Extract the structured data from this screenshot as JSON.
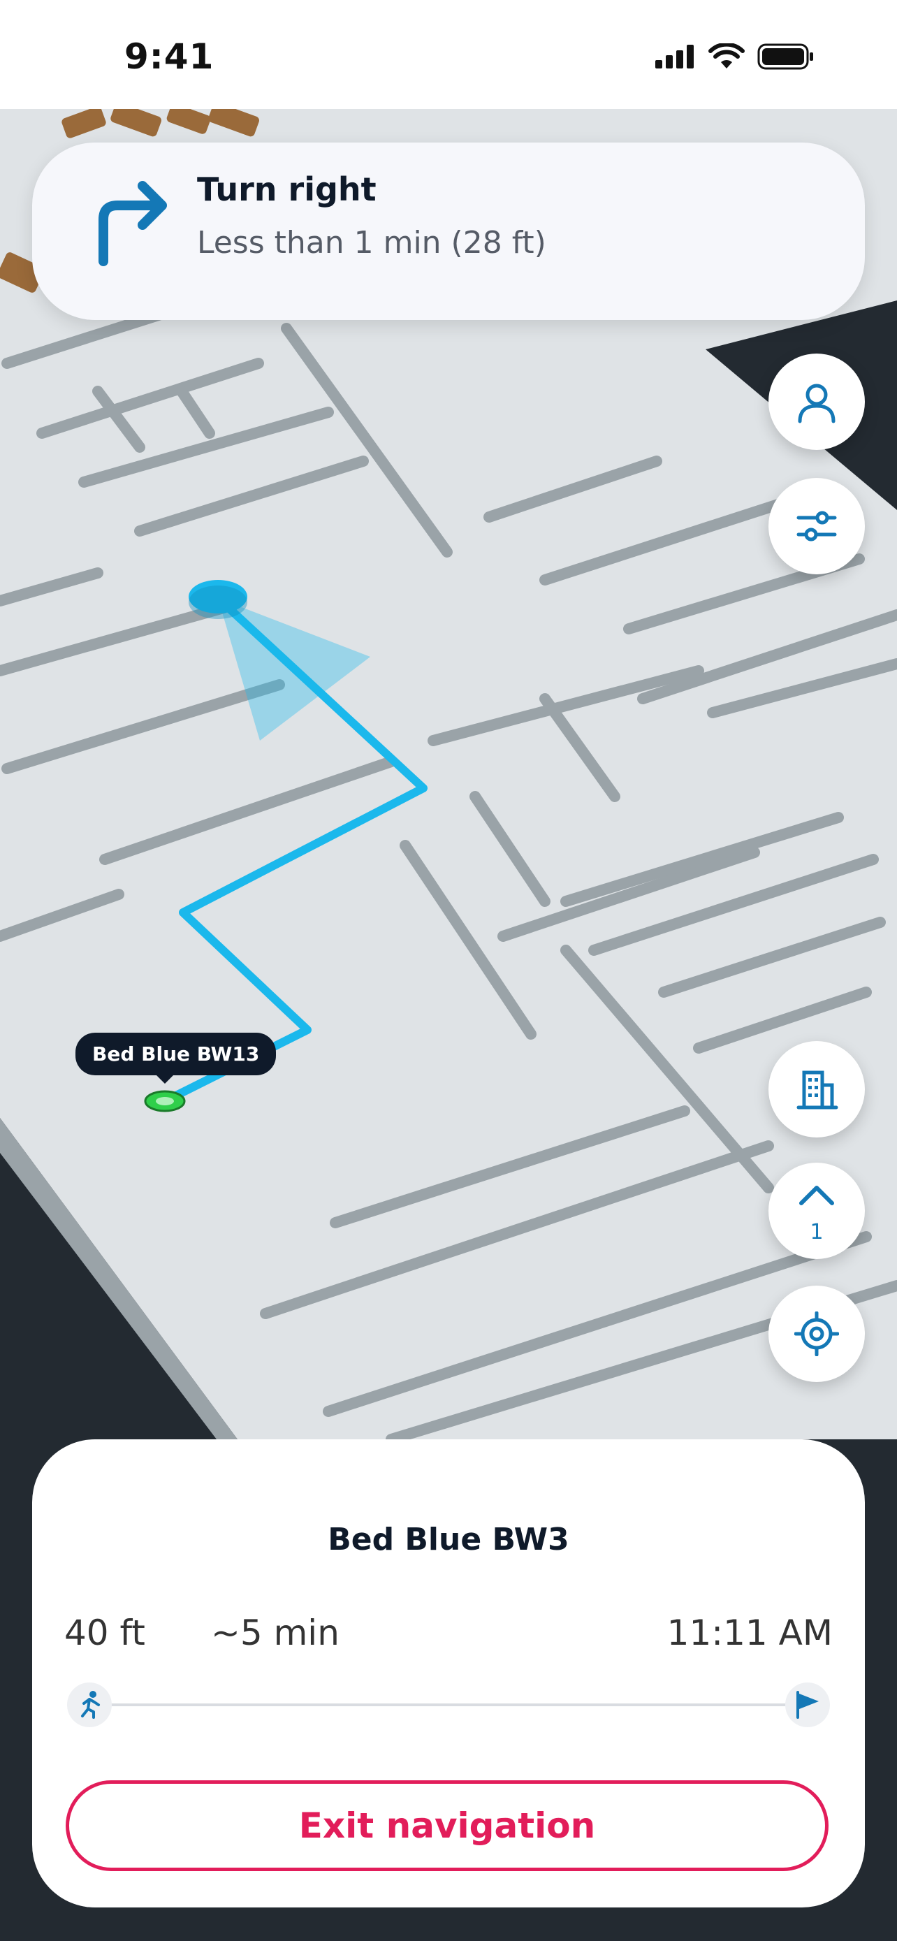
{
  "status_bar": {
    "time": "9:41"
  },
  "navigation": {
    "instruction": "Turn right",
    "detail": "Less than 1 min (28 ft)"
  },
  "map": {
    "marker_label": "Bed Blue BW13",
    "route_color": "#1bb8ec",
    "current_floor": "1"
  },
  "controls": {
    "icons": [
      "user-icon",
      "filter-sliders-icon",
      "building-icon",
      "chevron-up-icon",
      "locate-target-icon"
    ]
  },
  "trip": {
    "destination": "Bed Blue BW3",
    "distance": "40 ft",
    "duration": "~5 min",
    "arrival_time": "11:11 AM",
    "progress": 0
  },
  "actions": {
    "exit_label": "Exit navigation"
  },
  "colors": {
    "accent": "#1478b6",
    "danger": "#e21d5a",
    "route": "#1bb8ec"
  }
}
